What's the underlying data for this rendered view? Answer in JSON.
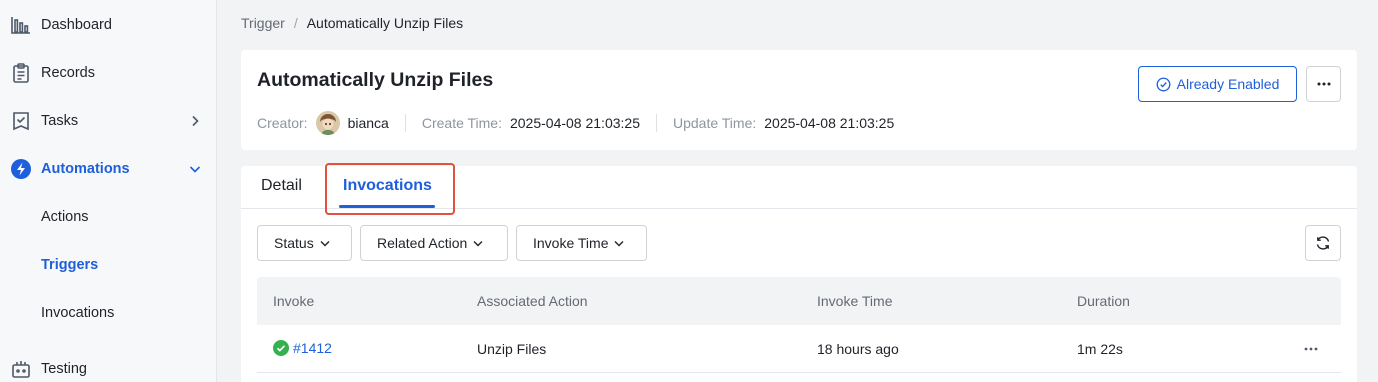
{
  "sidebar": {
    "items": [
      {
        "label": "Dashboard",
        "icon": "bar-chart-icon"
      },
      {
        "label": "Records",
        "icon": "clipboard-icon"
      },
      {
        "label": "Tasks",
        "icon": "task-list-icon"
      },
      {
        "label": "Automations",
        "icon": "automation-icon"
      },
      {
        "label": "Actions"
      },
      {
        "label": "Triggers"
      },
      {
        "label": "Invocations"
      },
      {
        "label": "Testing",
        "icon": "testing-icon"
      }
    ],
    "active_color": "#1f5fd9"
  },
  "breadcrumb": {
    "parent": "Trigger",
    "separator": "/",
    "current": "Automatically Unzip Files"
  },
  "header": {
    "title": "Automatically Unzip Files",
    "creator_label": "Creator:",
    "creator_name": "bianca",
    "create_time_label": "Create Time:",
    "create_time": "2025-04-08 21:03:25",
    "update_time_label": "Update Time:",
    "update_time": "2025-04-08 21:03:25",
    "status_button": "Already Enabled"
  },
  "tabs": [
    {
      "label": "Detail",
      "active": false
    },
    {
      "label": "Invocations",
      "active": true
    }
  ],
  "filters": {
    "status": "Status",
    "related_action": "Related Action",
    "invoke_time": "Invoke Time"
  },
  "table": {
    "columns": [
      "Invoke",
      "Associated Action",
      "Invoke Time",
      "Duration"
    ],
    "rows": [
      {
        "invoke": "#1412",
        "status": "success",
        "action": "Unzip Files",
        "invoke_time": "18 hours ago",
        "duration": "1m 22s"
      }
    ]
  },
  "colors": {
    "accent": "#1f5fd9",
    "highlight_border": "#e0523e",
    "success": "#34b04f"
  }
}
